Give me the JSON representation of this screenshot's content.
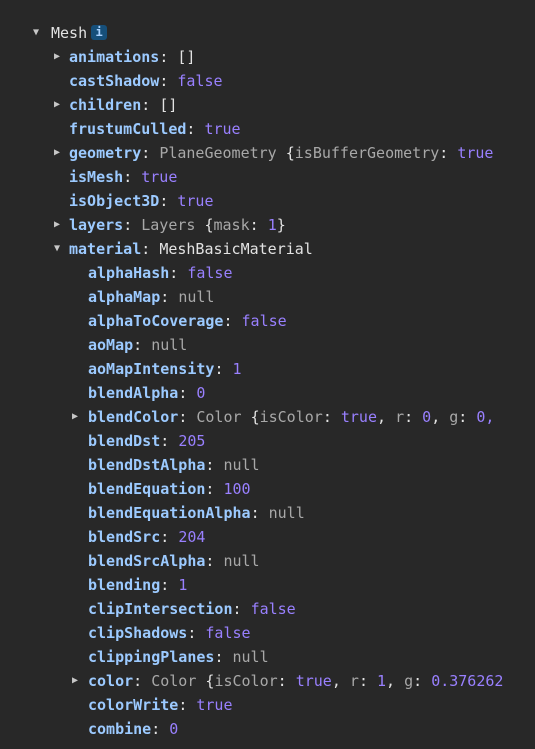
{
  "root": {
    "name": "Mesh",
    "info_icon_text": "i"
  },
  "l1": {
    "animations": {
      "key": "animations",
      "value": "[]"
    },
    "castShadow": {
      "key": "castShadow",
      "value": "false"
    },
    "children": {
      "key": "children",
      "value": "[]"
    },
    "frustumCulled": {
      "key": "frustumCulled",
      "value": "true"
    },
    "geometry": {
      "key": "geometry",
      "cls": "PlaneGeometry",
      "open": "{",
      "inner_key": "isBufferGeometry",
      "inner_value": "true"
    },
    "isMesh": {
      "key": "isMesh",
      "value": "true"
    },
    "isObject3D": {
      "key": "isObject3D",
      "value": "true"
    },
    "layers": {
      "key": "layers",
      "cls": "Layers",
      "open": "{",
      "inner_key": "mask",
      "inner_value": "1",
      "close": "}"
    },
    "material": {
      "key": "material",
      "cls": "MeshBasicMaterial"
    }
  },
  "mat": {
    "alphaHash": {
      "key": "alphaHash",
      "value": "false"
    },
    "alphaMap": {
      "key": "alphaMap",
      "value": "null"
    },
    "alphaToCoverage": {
      "key": "alphaToCoverage",
      "value": "false"
    },
    "aoMap": {
      "key": "aoMap",
      "value": "null"
    },
    "aoMapIntensity": {
      "key": "aoMapIntensity",
      "value": "1"
    },
    "blendAlpha": {
      "key": "blendAlpha",
      "value": "0"
    },
    "blendColor": {
      "key": "blendColor",
      "cls": "Color",
      "open": "{",
      "k1": "isColor",
      "v1": "true",
      "k2": "r",
      "v2": "0",
      "k3": "g",
      "v3": "0,"
    },
    "blendDst": {
      "key": "blendDst",
      "value": "205"
    },
    "blendDstAlpha": {
      "key": "blendDstAlpha",
      "value": "null"
    },
    "blendEquation": {
      "key": "blendEquation",
      "value": "100"
    },
    "blendEquationAlpha": {
      "key": "blendEquationAlpha",
      "value": "null"
    },
    "blendSrc": {
      "key": "blendSrc",
      "value": "204"
    },
    "blendSrcAlpha": {
      "key": "blendSrcAlpha",
      "value": "null"
    },
    "blending": {
      "key": "blending",
      "value": "1"
    },
    "clipIntersection": {
      "key": "clipIntersection",
      "value": "false"
    },
    "clipShadows": {
      "key": "clipShadows",
      "value": "false"
    },
    "clippingPlanes": {
      "key": "clippingPlanes",
      "value": "null"
    },
    "color": {
      "key": "color",
      "cls": "Color",
      "open": "{",
      "k1": "isColor",
      "v1": "true",
      "k2": "r",
      "v2": "1",
      "k3": "g",
      "v3": "0.376262"
    },
    "colorWrite": {
      "key": "colorWrite",
      "value": "true"
    },
    "combine": {
      "key": "combine",
      "value": "0"
    }
  },
  "colors": {
    "background": "#282828",
    "key": "#9ccaff",
    "keyword": "#9980ff",
    "null_class": "#a8a8a8",
    "text": "#e3e3e3",
    "badge": "#164f7a"
  },
  "icons": {
    "expanded": "triangle-down-icon",
    "collapsed": "triangle-right-icon",
    "info": "info-icon"
  }
}
